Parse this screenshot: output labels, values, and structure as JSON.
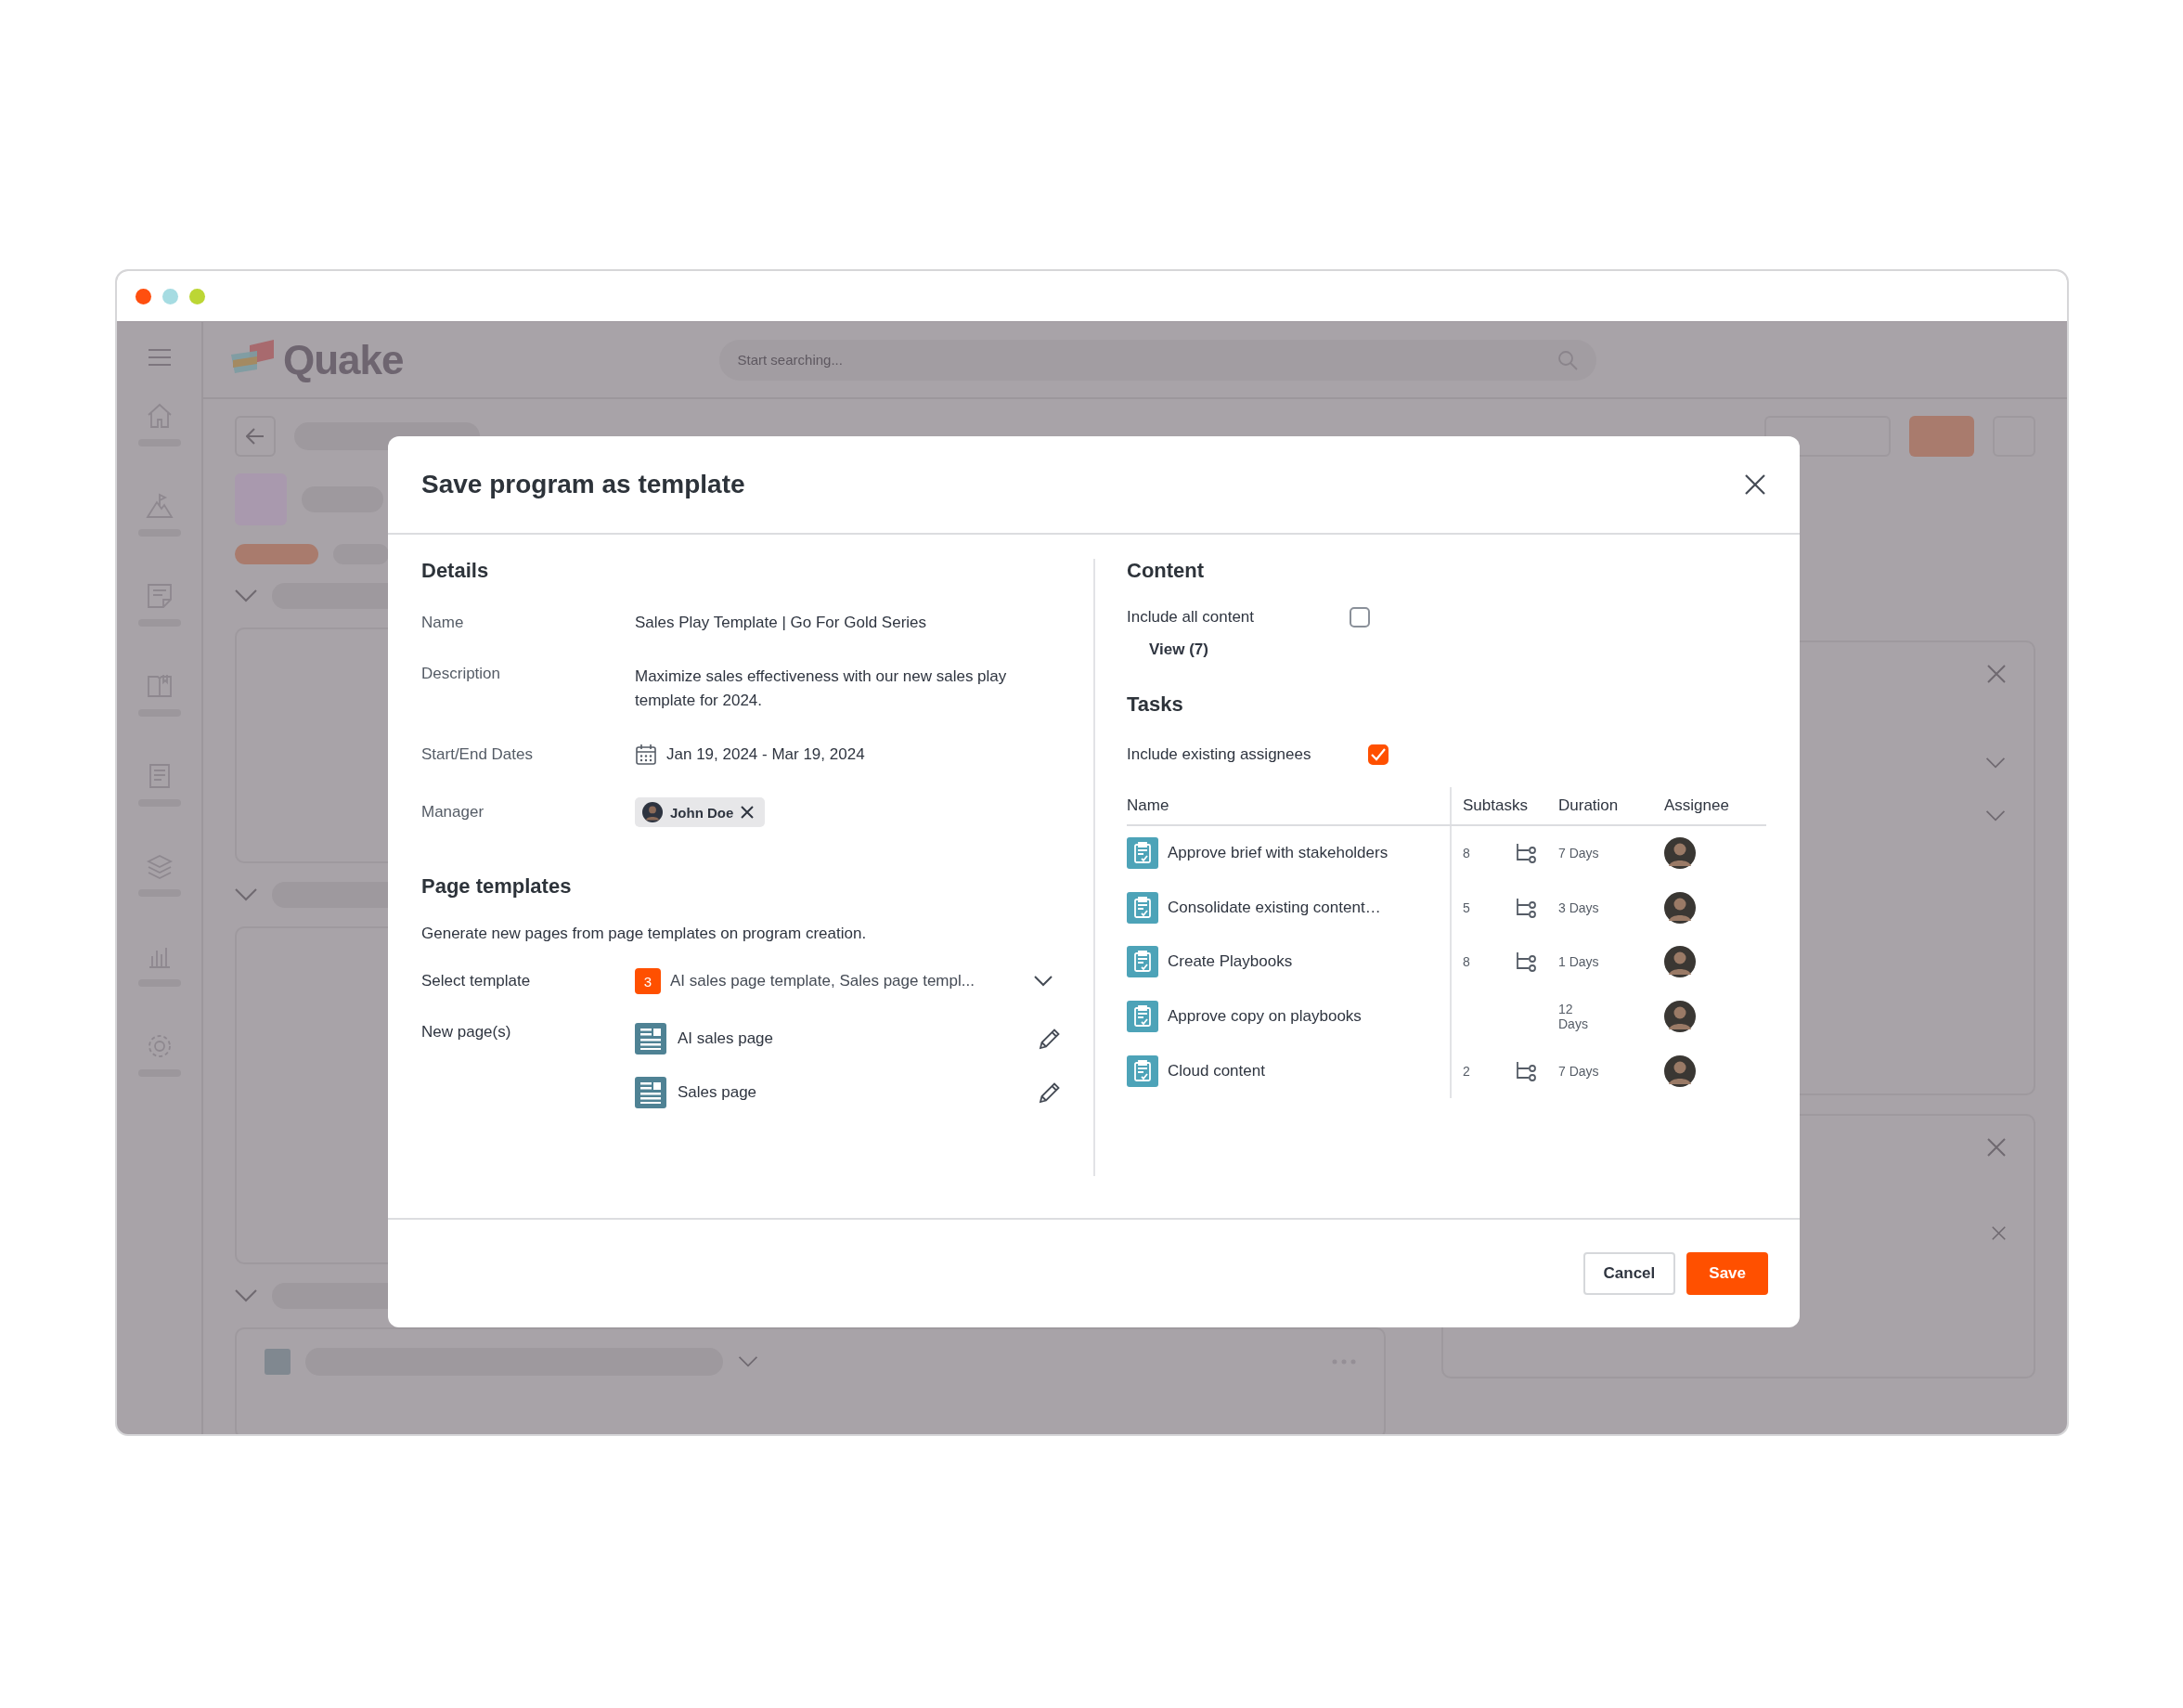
{
  "app": {
    "logo": "Quake",
    "search": {
      "placeholder": "Start searching..."
    }
  },
  "dialog": {
    "title": "Save program as template",
    "details": {
      "heading": "Details",
      "fields": [
        {
          "kind": "text",
          "label": "Name",
          "value": "Sales Play Template | Go For Gold Series"
        },
        {
          "kind": "text",
          "label": "Description",
          "value": "Maximize sales effectiveness with our new sales play template for 2024."
        },
        {
          "kind": "dates",
          "label": "Start/End Dates",
          "value": "Jan 19, 2024 -  Mar 19, 2024"
        },
        {
          "kind": "person",
          "label": "Manager",
          "value": "John Doe"
        }
      ]
    },
    "page_templates": {
      "heading": "Page templates",
      "description": "Generate new pages from page templates on program creation.",
      "select": {
        "label": "Select template",
        "count": "3",
        "value": "AI sales page template, Sales page templ..."
      },
      "new_pages": {
        "label": "New page(s)",
        "pages": [
          "AI sales page",
          "Sales page"
        ]
      }
    },
    "content": {
      "heading": "Content",
      "include_all": {
        "label": "Include all content",
        "checked": false
      },
      "view_link": "View (7)"
    },
    "tasks": {
      "heading": "Tasks",
      "include_assignees": {
        "label": "Include existing assignees",
        "checked": true
      },
      "columns": [
        "Name",
        "Subtasks",
        "Duration",
        "Assignee"
      ],
      "rows": [
        {
          "name": "Approve brief with stakeholders",
          "subtasks": "8",
          "duration": "7 Days"
        },
        {
          "name": "Consolidate existing content…",
          "subtasks": "5",
          "duration": "3 Days"
        },
        {
          "name": "Create Playbooks",
          "subtasks": "8",
          "duration": "1 Days"
        },
        {
          "name": "Approve copy on playbooks",
          "duration": "12 Days"
        },
        {
          "name": "Cloud content",
          "subtasks": "2",
          "duration": "7 Days"
        }
      ]
    },
    "buttons": [
      {
        "kind": "secondary",
        "label": "Cancel"
      },
      {
        "kind": "primary",
        "label": "Save"
      }
    ]
  }
}
